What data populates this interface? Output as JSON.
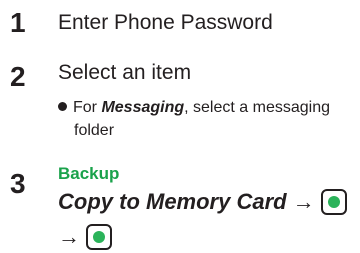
{
  "steps": [
    {
      "number": "1",
      "text": "Enter Phone Password"
    },
    {
      "number": "2",
      "text": "Select an item"
    },
    {
      "number": "3"
    }
  ],
  "bullet": {
    "lead": "For ",
    "emphasis": "Messaging",
    "rest": ", select a messaging",
    "line2": "folder"
  },
  "step3": {
    "category": "Backup",
    "command": "Copy to Memory Card",
    "arrow": "→",
    "key_icon": "center-key-icon",
    "key_color": "#2bb35a",
    "category_color": "#1aa24b"
  }
}
